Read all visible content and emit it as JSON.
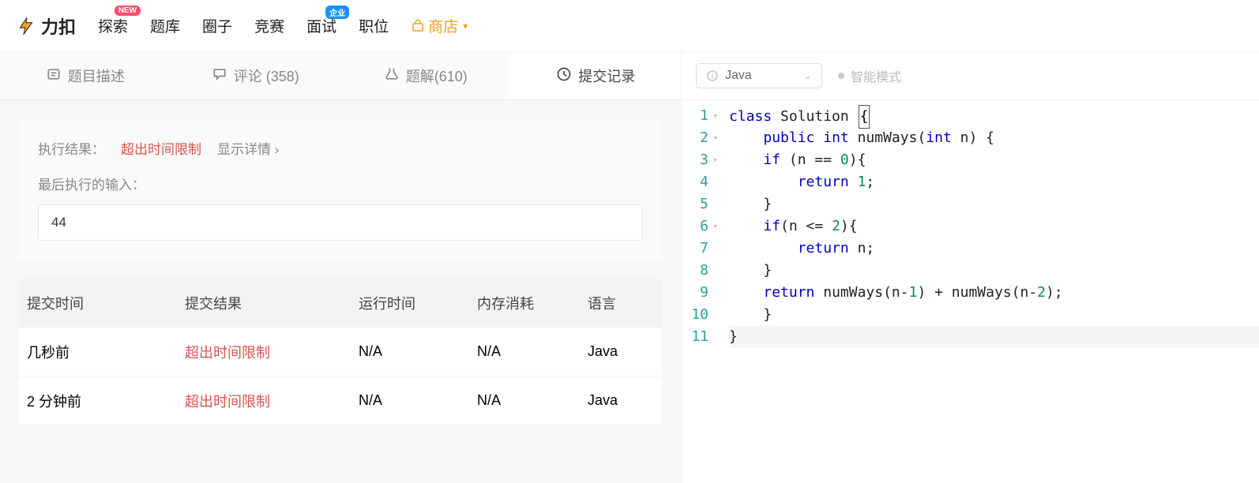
{
  "nav": {
    "logo": "力扣",
    "items": [
      "探索",
      "题库",
      "圈子",
      "竞赛",
      "面试",
      "职位"
    ],
    "badges": {
      "0": "NEW",
      "4": "企业"
    },
    "shop": "商店"
  },
  "leftTabs": [
    {
      "label": "题目描述"
    },
    {
      "label": "评论 (358)"
    },
    {
      "label": "题解(610)"
    },
    {
      "label": "提交记录",
      "active": true
    }
  ],
  "result": {
    "label": "执行结果：",
    "status": "超出时间限制",
    "more": "显示详情 ›",
    "lastInputLabel": "最后执行的输入：",
    "lastInput": "44"
  },
  "table": {
    "headers": [
      "提交时间",
      "提交结果",
      "运行时间",
      "内存消耗",
      "语言"
    ],
    "rows": [
      {
        "time": "几秒前",
        "result": "超出时间限制",
        "runtime": "N/A",
        "memory": "N/A",
        "lang": "Java"
      },
      {
        "time": "2 分钟前",
        "result": "超出时间限制",
        "runtime": "N/A",
        "memory": "N/A",
        "lang": "Java"
      }
    ]
  },
  "editor": {
    "language": "Java",
    "smartMode": "智能模式",
    "code": [
      {
        "n": 1,
        "fold": true,
        "tokens": [
          [
            "kw",
            "class"
          ],
          [
            "plain",
            " Solution "
          ],
          [
            "cursor",
            "{"
          ]
        ]
      },
      {
        "n": 2,
        "fold": true,
        "tokens": [
          [
            "plain",
            "    "
          ],
          [
            "kw",
            "public"
          ],
          [
            "plain",
            " "
          ],
          [
            "type",
            "int"
          ],
          [
            "plain",
            " numWays("
          ],
          [
            "type",
            "int"
          ],
          [
            "plain",
            " n) {"
          ]
        ]
      },
      {
        "n": 3,
        "fold": true,
        "tokens": [
          [
            "plain",
            "    "
          ],
          [
            "kw",
            "if"
          ],
          [
            "plain",
            " (n == "
          ],
          [
            "num",
            "0"
          ],
          [
            "plain",
            "){"
          ]
        ]
      },
      {
        "n": 4,
        "tokens": [
          [
            "plain",
            "        "
          ],
          [
            "kw",
            "return"
          ],
          [
            "plain",
            " "
          ],
          [
            "num",
            "1"
          ],
          [
            "plain",
            ";"
          ]
        ]
      },
      {
        "n": 5,
        "tokens": [
          [
            "plain",
            "    }"
          ]
        ]
      },
      {
        "n": 6,
        "fold": true,
        "tokens": [
          [
            "plain",
            "    "
          ],
          [
            "kw",
            "if"
          ],
          [
            "plain",
            "(n <= "
          ],
          [
            "num",
            "2"
          ],
          [
            "plain",
            "){"
          ]
        ]
      },
      {
        "n": 7,
        "tokens": [
          [
            "plain",
            "        "
          ],
          [
            "kw",
            "return"
          ],
          [
            "plain",
            " n;"
          ]
        ]
      },
      {
        "n": 8,
        "tokens": [
          [
            "plain",
            "    }"
          ]
        ]
      },
      {
        "n": 9,
        "tokens": [
          [
            "plain",
            "    "
          ],
          [
            "kw",
            "return"
          ],
          [
            "plain",
            " numWays(n-"
          ],
          [
            "num",
            "1"
          ],
          [
            "plain",
            ") + numWays(n-"
          ],
          [
            "num",
            "2"
          ],
          [
            "plain",
            ");"
          ]
        ]
      },
      {
        "n": 10,
        "tokens": [
          [
            "plain",
            "    }"
          ]
        ]
      },
      {
        "n": 11,
        "hl": true,
        "tokens": [
          [
            "plain",
            "}"
          ]
        ]
      }
    ]
  }
}
